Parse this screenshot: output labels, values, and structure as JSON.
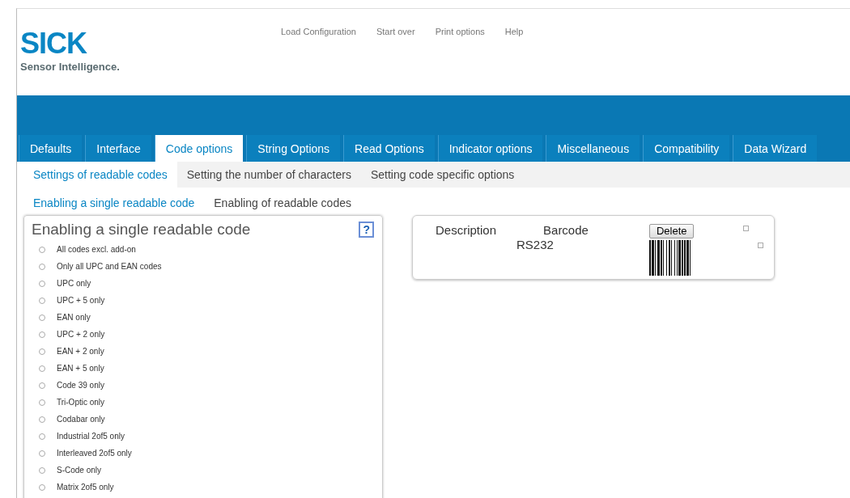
{
  "logo": {
    "name": "SICK",
    "tagline": "Sensor Intelligence."
  },
  "top_links": [
    "Load Configuration",
    "Start over",
    "Print options",
    "Help"
  ],
  "tabs": [
    {
      "label": "Defaults",
      "selected": false
    },
    {
      "label": "Interface",
      "selected": false
    },
    {
      "label": "Code options",
      "selected": true
    },
    {
      "label": "String Options",
      "selected": false
    },
    {
      "label": "Read Options",
      "selected": false
    },
    {
      "label": "Indicator options",
      "selected": false
    },
    {
      "label": "Miscellaneous",
      "selected": false
    },
    {
      "label": "Compatibility",
      "selected": false
    },
    {
      "label": "Data Wizard",
      "selected": false
    }
  ],
  "subtabs": [
    {
      "label": "Settings of readable codes",
      "selected": true
    },
    {
      "label": "Setting the number of characters",
      "selected": false
    },
    {
      "label": "Setting code specific options",
      "selected": false
    }
  ],
  "subsubtabs": [
    {
      "label": "Enabling a single readable code",
      "selected": true
    },
    {
      "label": "Enabling of readable codes",
      "selected": false
    }
  ],
  "panel": {
    "title": "Enabling a single readable code",
    "help": "?",
    "options": [
      {
        "label": "All codes excl. add-on",
        "selected": false
      },
      {
        "label": "Only all UPC and EAN codes",
        "selected": false
      },
      {
        "label": "UPC only",
        "selected": false
      },
      {
        "label": "UPC + 5 only",
        "selected": false
      },
      {
        "label": "EAN only",
        "selected": false
      },
      {
        "label": "UPC + 2 only",
        "selected": false
      },
      {
        "label": "EAN + 2 only",
        "selected": false
      },
      {
        "label": "EAN + 5 only",
        "selected": false
      },
      {
        "label": "Code 39 only",
        "selected": false
      },
      {
        "label": "Tri-Optic only",
        "selected": false
      },
      {
        "label": "Codabar only",
        "selected": false
      },
      {
        "label": "Industrial 2of5 only",
        "selected": false
      },
      {
        "label": "Interleaved 2of5 only",
        "selected": false
      },
      {
        "label": "S-Code only",
        "selected": false
      },
      {
        "label": "Matrix 2of5 only",
        "selected": false
      }
    ]
  },
  "barcode_card": {
    "columns": [
      "Description",
      "Barcode"
    ],
    "description": "RS232",
    "delete_button": "Delete"
  }
}
